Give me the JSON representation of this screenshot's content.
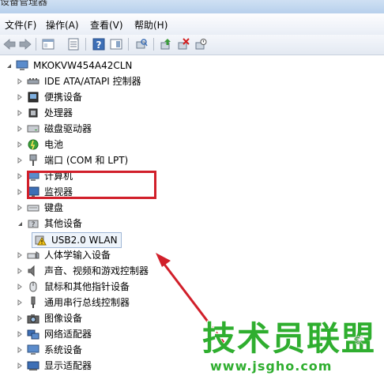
{
  "window": {
    "title": "设备管理器"
  },
  "menu": [
    {
      "label": "文件(F)"
    },
    {
      "label": "操作(A)"
    },
    {
      "label": "查看(V)"
    },
    {
      "label": "帮助(H)"
    }
  ],
  "tree": {
    "root": "MKOKVW454A42CLN",
    "items": [
      {
        "label": "IDE ATA/ATAPI 控制器",
        "icon": "ide-controller-icon"
      },
      {
        "label": "便携设备",
        "icon": "portable-device-icon"
      },
      {
        "label": "处理器",
        "icon": "processor-icon"
      },
      {
        "label": "磁盘驱动器",
        "icon": "disk-drive-icon"
      },
      {
        "label": "电池",
        "icon": "battery-icon"
      },
      {
        "label": "端口 (COM 和 LPT)",
        "icon": "port-icon"
      },
      {
        "label": "计算机",
        "icon": "computer-icon"
      },
      {
        "label": "监视器",
        "icon": "monitor-icon"
      },
      {
        "label": "键盘",
        "icon": "keyboard-icon"
      },
      {
        "label": "其他设备",
        "icon": "other-devices-icon"
      },
      {
        "label": "人体学输入设备",
        "icon": "hid-icon"
      },
      {
        "label": "声音、视频和游戏控制器",
        "icon": "sound-icon"
      },
      {
        "label": "鼠标和其他指针设备",
        "icon": "mouse-icon"
      },
      {
        "label": "通用串行总线控制器",
        "icon": "usb-icon"
      },
      {
        "label": "图像设备",
        "icon": "camera-icon"
      },
      {
        "label": "网络适配器",
        "icon": "network-icon"
      },
      {
        "label": "系统设备",
        "icon": "system-icon"
      },
      {
        "label": "显示适配器",
        "icon": "display-adapter-icon"
      }
    ],
    "child": {
      "label": "USB2.0 WLAN",
      "icon": "warning-icon"
    }
  },
  "annotation_color": "#d11f2a",
  "watermark": {
    "big": "技术员联盟",
    "small": "www.jsgho.com",
    "side": "家"
  }
}
